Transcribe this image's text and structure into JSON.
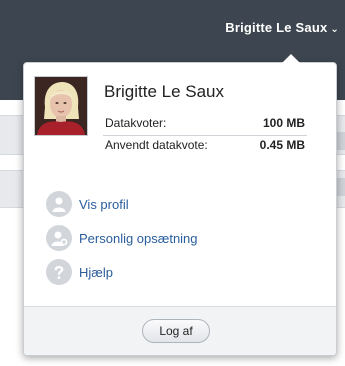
{
  "header": {
    "user_name": "Brigitte Le Saux",
    "caret": "⌄"
  },
  "popover": {
    "name": "Brigitte Le Saux",
    "quota": [
      {
        "label": "Datakvoter:",
        "value": "100 MB"
      },
      {
        "label": "Anvendt datakvote:",
        "value": "0.45 MB"
      }
    ],
    "menu": [
      {
        "label": "Vis profil",
        "icon": "person-icon"
      },
      {
        "label": "Personlig opsætning",
        "icon": "settings-person-icon"
      },
      {
        "label": "Hjælp",
        "icon": "help-icon"
      }
    ],
    "logout_label": "Log af"
  },
  "colors": {
    "header_bg": "#3d4650",
    "link": "#2a5d9c",
    "icon_bg": "#d2d6db"
  }
}
